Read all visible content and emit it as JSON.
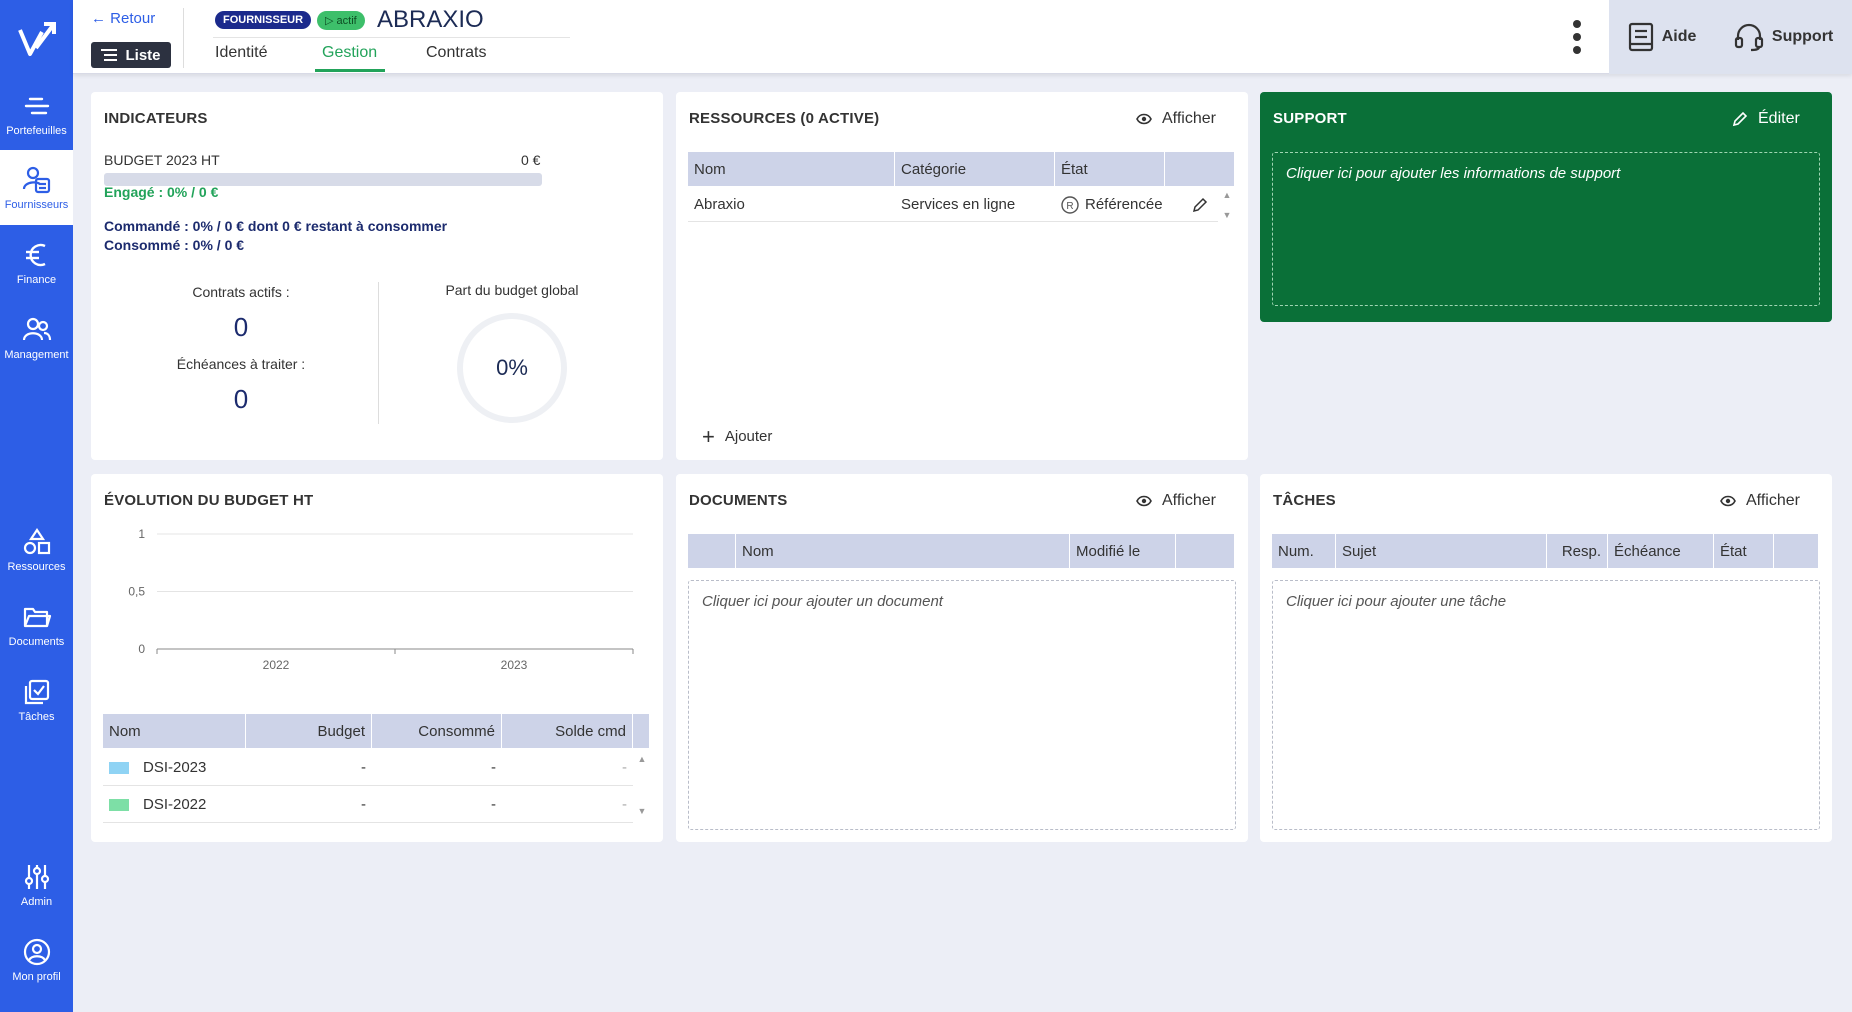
{
  "sidebar": {
    "items": [
      {
        "label": "Portefeuilles",
        "icon": "portfolio-icon"
      },
      {
        "label": "Fournisseurs",
        "icon": "supplier-icon"
      },
      {
        "label": "Finance",
        "icon": "euro-icon"
      },
      {
        "label": "Management",
        "icon": "people-icon"
      },
      {
        "label": "Ressources",
        "icon": "shapes-icon"
      },
      {
        "label": "Documents",
        "icon": "folder-icon"
      },
      {
        "label": "Tâches",
        "icon": "tasks-icon"
      },
      {
        "label": "Admin",
        "icon": "sliders-icon"
      },
      {
        "label": "Mon profil",
        "icon": "profile-icon"
      }
    ],
    "active": "Fournisseurs",
    "color": "#2d5ee6"
  },
  "header": {
    "back": "Retour",
    "list": "Liste",
    "badge_type": "FOURNISSEUR",
    "badge_status": "▷ actif",
    "name": "ABRAXIO",
    "tabs": [
      "Identité",
      "Gestion",
      "Contrats"
    ],
    "active_tab": "Gestion",
    "help": "Aide",
    "support": "Support"
  },
  "indicators": {
    "title": "INDICATEURS",
    "budget_label": "BUDGET 2023 HT",
    "budget_value": "0 €",
    "budget_fill": 0,
    "engage": "Engagé : 0% / 0 €",
    "commande": "Commandé : 0% / 0 € dont 0 € restant à consommer",
    "consomme": "Consommé : 0% / 0 €",
    "contrats_label": "Contrats actifs :",
    "contrats_value": "0",
    "echeances_label": "Échéances à traiter :",
    "echeances_value": "0",
    "part_label": "Part du budget global",
    "part_value": "0%"
  },
  "resources": {
    "title": "RESSOURCES (0 ACTIVE)",
    "afficher": "Afficher",
    "columns": [
      "Nom",
      "Catégorie",
      "État"
    ],
    "rows": [
      {
        "nom": "Abraxio",
        "categorie": "Services en ligne",
        "etat": "Référencée"
      }
    ],
    "add": "Ajouter"
  },
  "support": {
    "title": "SUPPORT",
    "edit": "Éditer",
    "placeholder": "Cliquer ici pour ajouter les informations de support",
    "color": "#0a7038"
  },
  "budget_evolution": {
    "title": "ÉVOLUTION DU BUDGET HT",
    "columns": [
      "Nom",
      "Budget",
      "Consommé",
      "Solde cmd"
    ],
    "rows": [
      {
        "nom": "DSI-2023",
        "budget": "-",
        "consomme": "-",
        "solde": "-",
        "color": "#8fd3f4"
      },
      {
        "nom": "DSI-2022",
        "budget": "-",
        "consomme": "-",
        "solde": "-",
        "color": "#7ddfa6"
      }
    ]
  },
  "chart_data": {
    "type": "line",
    "x": [
      "2022",
      "2023"
    ],
    "yticks": [
      "1",
      "0,5",
      "0"
    ],
    "ylim": [
      0,
      1
    ],
    "series": [],
    "grid": true
  },
  "documents": {
    "title": "DOCUMENTS",
    "afficher": "Afficher",
    "columns": [
      "",
      "Nom",
      "Modifié le"
    ],
    "placeholder": "Cliquer ici pour ajouter un document"
  },
  "tasks": {
    "title": "TÂCHES",
    "afficher": "Afficher",
    "columns": [
      "Num.",
      "Sujet",
      "Resp.",
      "Échéance",
      "État"
    ],
    "placeholder": "Cliquer ici pour ajouter une tâche"
  }
}
